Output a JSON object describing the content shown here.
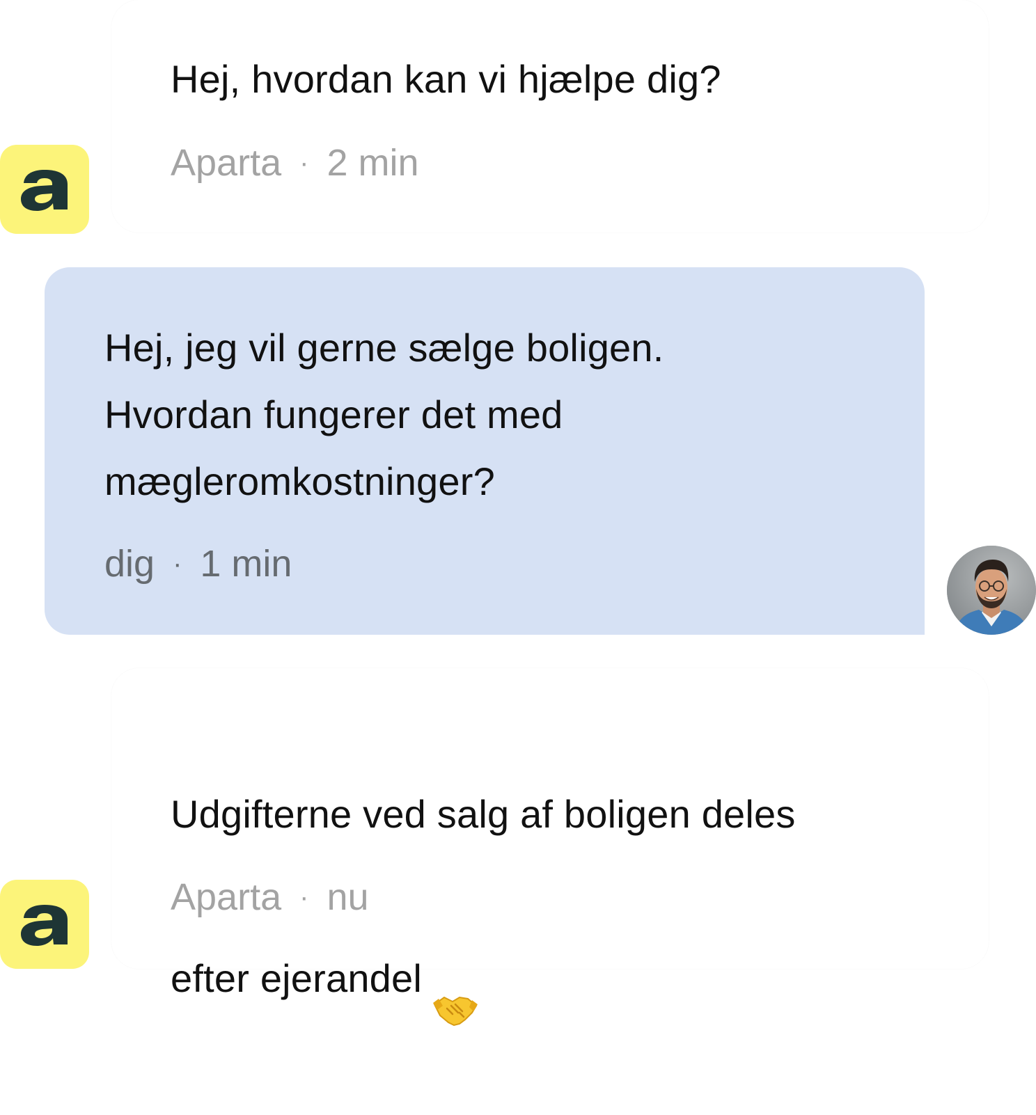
{
  "messages": [
    {
      "sender": "Aparta",
      "text": "Hej, hvordan kan vi hjælpe dig?",
      "time": "2 min"
    },
    {
      "sender": "dig",
      "text": "Hej, jeg vil gerne sælge boligen.\nHvordan fungerer det med\nmægleromkostninger?",
      "time": "1 min"
    },
    {
      "sender": "Aparta",
      "text_line1": "Udgifterne ved salg af boligen deles",
      "text_line2": "efter ejerandel",
      "emoji": "handshake-icon",
      "time": "nu"
    }
  ],
  "separator": "·",
  "colors": {
    "logo_bg": "#fcf47a",
    "logo_fg": "#1e3535",
    "user_bubble": "#d6e1f4",
    "meta_agent": "#a3a3a3",
    "meta_user": "#666b70"
  }
}
